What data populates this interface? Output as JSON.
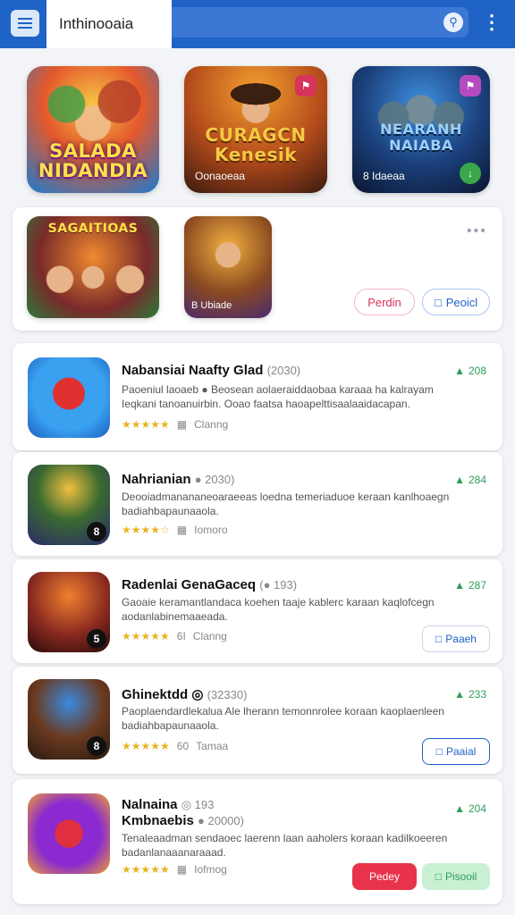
{
  "app": {
    "title": "Inthinooaia"
  },
  "colors": {
    "primary": "#1f63c6",
    "accent_red": "#e8334a",
    "accent_green": "#2e9e5b",
    "star": "#e8b321"
  },
  "header": {
    "menu_icon": "hamburger-icon",
    "search_icon": "search-icon",
    "more_icon": "more-vertical-icon"
  },
  "featured": [
    {
      "title": "SALADA\nNIDANDIA"
    },
    {
      "title": "CURAGCN\nKenesik",
      "subtitle": "Oonaoeaa"
    },
    {
      "title": "NEARANH\nNAIABA",
      "subtitle": "8 Idaeaa"
    }
  ],
  "panel": {
    "tile1_title": "SAGAITIOAS",
    "tile2_subtitle": "B Ubiade",
    "btn_primary": "Perdin",
    "btn_secondary": "Peoicl"
  },
  "list": [
    {
      "name": "Nabansiai Naafty Glad",
      "num": "(2030)",
      "desc": "Paoeniul laoaeb ● Beosean aolaeraiddaobaa karaaa ha kalrayam Ieqkani tanoanuirbin. Ooao faatsa haoapelttisaalaaidacapan.",
      "rating_meta": "Clanng",
      "score": "208"
    },
    {
      "name": "Nahrianian",
      "num": "● 2030)",
      "desc": "Deooiadmanananeoaraeeas loedna temeriaduoe keraan kanlhoaegn badiahbapaunaaola.",
      "rating_meta": "Iomoro",
      "score": "284"
    },
    {
      "name": "Radenlai GenaGaceq",
      "num": "(● 193)",
      "desc": "Gaoaie keramantlandaca koehen taaje kablerc karaan kaqlofcegn aodanlabinemaaeada.",
      "rating_meta": "Clanng",
      "rating_num": "6I",
      "score": "287",
      "action": "Paaeh"
    },
    {
      "name": "Ghinektdd ◎",
      "num": "(32330)",
      "desc": "Paoplaendardlekalua Ale lherann temonnrolee koraan kaoplaenleen badiahbapaunaaola.",
      "rating_meta": "Tamaa",
      "rating_num": "60",
      "score": "233",
      "action": "Paaial"
    },
    {
      "name": "Nalnaina",
      "num": "◎ 193",
      "name2": "Kmbnaebis",
      "num2": "● 20000)",
      "desc": "Tenaleaadman sendaoec laerenn laan aaholers koraan kadilkoeeren badanlanaaanaraaad.",
      "rating_meta": "Iofmog",
      "score": "204",
      "action_red": "Pedey",
      "action_green": "Pisooil"
    }
  ]
}
